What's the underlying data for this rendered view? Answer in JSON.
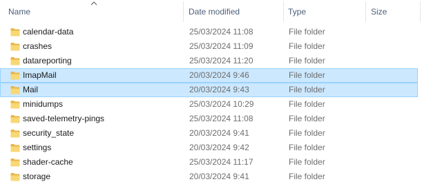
{
  "columns": {
    "name": "Name",
    "date_modified": "Date modified",
    "type": "Type",
    "size": "Size"
  },
  "sort": {
    "column": "name",
    "direction": "ascending",
    "indicator_icon": "sort-up-chevron-icon"
  },
  "colors": {
    "selection_fill": "#cce8ff",
    "selection_border": "#99d1ff",
    "folder_yellow": "#f8d775",
    "folder_dark": "#e8b547",
    "header_text": "#4c607a",
    "secondary_text": "#6d6d6d"
  },
  "rows": [
    {
      "name": "calendar-data",
      "date": "25/03/2024 11:08",
      "type": "File folder",
      "size": "",
      "icon": "folder-icon",
      "selected": false
    },
    {
      "name": "crashes",
      "date": "25/03/2024 11:09",
      "type": "File folder",
      "size": "",
      "icon": "folder-icon",
      "selected": false
    },
    {
      "name": "datareporting",
      "date": "25/03/2024 11:20",
      "type": "File folder",
      "size": "",
      "icon": "folder-icon",
      "selected": false
    },
    {
      "name": "ImapMail",
      "date": "20/03/2024 9:46",
      "type": "File folder",
      "size": "",
      "icon": "folder-icon",
      "selected": true
    },
    {
      "name": "Mail",
      "date": "20/03/2024 9:43",
      "type": "File folder",
      "size": "",
      "icon": "folder-icon",
      "selected": true
    },
    {
      "name": "minidumps",
      "date": "25/03/2024 10:29",
      "type": "File folder",
      "size": "",
      "icon": "folder-icon",
      "selected": false
    },
    {
      "name": "saved-telemetry-pings",
      "date": "25/03/2024 11:08",
      "type": "File folder",
      "size": "",
      "icon": "folder-icon",
      "selected": false
    },
    {
      "name": "security_state",
      "date": "20/03/2024 9:41",
      "type": "File folder",
      "size": "",
      "icon": "folder-icon",
      "selected": false
    },
    {
      "name": "settings",
      "date": "20/03/2024 9:42",
      "type": "File folder",
      "size": "",
      "icon": "folder-icon",
      "selected": false
    },
    {
      "name": "shader-cache",
      "date": "25/03/2024 11:17",
      "type": "File folder",
      "size": "",
      "icon": "folder-icon",
      "selected": false
    },
    {
      "name": "storage",
      "date": "20/03/2024 9:41",
      "type": "File folder",
      "size": "",
      "icon": "folder-icon",
      "selected": false
    }
  ]
}
